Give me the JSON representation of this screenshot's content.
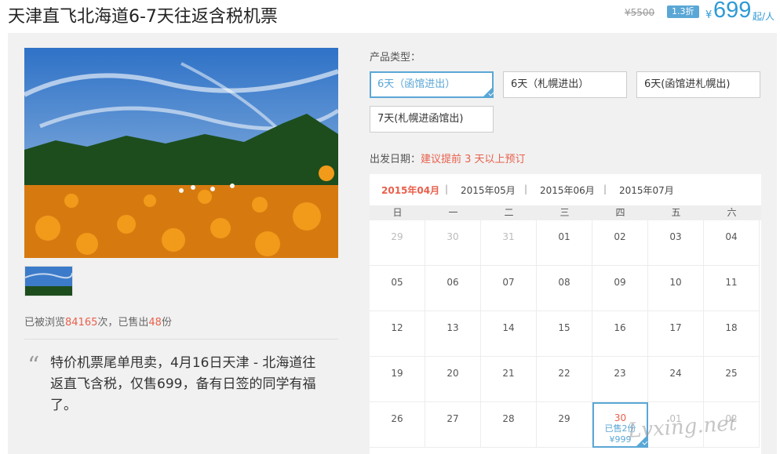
{
  "header": {
    "title": "天津直飞北海道6-7天往返含税机票",
    "original_price": "¥5500",
    "discount": "1.3折",
    "currency": "¥",
    "price": "699",
    "unit": "起/人"
  },
  "stats": {
    "prefix": "已被浏览",
    "views": "84165",
    "middle": "次，已售出",
    "sold": "48",
    "suffix": "份"
  },
  "quote": {
    "mark": "“",
    "text": "特价机票尾单甩卖，4月16日天津 - 北海道往返直飞含税，仅售699，备有日签的同学有福了。"
  },
  "product_type": {
    "label": "产品类型：",
    "options": [
      "6天（函馆进出）",
      "6天（札幌进出）",
      "6天(函馆进札幌出)",
      "7天(札幌进函馆出)"
    ]
  },
  "departure": {
    "label": "出发日期：",
    "tip": "建议提前 3 天以上预订"
  },
  "calendar": {
    "months": [
      "2015年04月",
      "2015年05月",
      "2015年06月",
      "2015年07月"
    ],
    "separator": "|",
    "weekdays": [
      "日",
      "一",
      "二",
      "三",
      "四",
      "五",
      "六"
    ],
    "days": [
      "29",
      "30",
      "31",
      "01",
      "02",
      "03",
      "04",
      "05",
      "06",
      "07",
      "08",
      "09",
      "10",
      "11",
      "12",
      "13",
      "14",
      "15",
      "16",
      "17",
      "18",
      "19",
      "20",
      "21",
      "22",
      "23",
      "24",
      "25",
      "26",
      "27",
      "28",
      "29",
      "30",
      "01",
      "02"
    ],
    "selected_sold": "已售2份",
    "selected_price": "¥999"
  },
  "watermark": "Lvxing.net",
  "colors": {
    "accent": "#5aa7d6",
    "price": "#2e9ad6",
    "highlight": "#e8604c"
  }
}
